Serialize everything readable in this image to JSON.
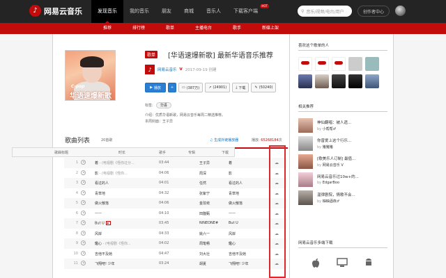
{
  "app": {
    "brand": "网易云音乐",
    "logo_glyph": "♪"
  },
  "nav": [
    "发现音乐",
    "我的音乐",
    "朋友",
    "商城",
    "音乐人",
    "下载客户端"
  ],
  "nav_hot": "HOT",
  "search": {
    "placeholder": "音乐/视频/电台/用户"
  },
  "creator_center": "创作者中心",
  "subnav": [
    "推荐",
    "排行榜",
    "歌单",
    "主播电台",
    "歌手",
    "新碟上架"
  ],
  "playlist": {
    "tag": "歌单",
    "title": "[华语速爆新歌] 最新华语音乐推荐",
    "cover_cpop": "C-pop",
    "cover_title": "华语速爆新歌",
    "creator": "网易云音乐",
    "creator_badge": "V",
    "date": "2017-09-19 创建",
    "buttons": {
      "play": "播放",
      "collect": "(387万)",
      "share": "(24901)",
      "download": "下载",
      "comment": "(50240)"
    },
    "tags_label": "标签:",
    "tag_value": "华语",
    "intro": "介绍：优质华语新歌，网易云音乐每周二精选推荐。",
    "update": "本周封面：王子异"
  },
  "list": {
    "title": "歌曲列表",
    "count": "20首歌",
    "external": "生成外链播放器",
    "plays_label": "播放:",
    "plays_value": "65268184",
    "plays_unit": "次",
    "headers": {
      "title": "歌曲标题",
      "time": "时长",
      "singer": "歌手",
      "album": "专辑",
      "download": "下载"
    },
    "rows": [
      {
        "num": "1",
        "name": "着",
        "alias": " - (电视剧《怪你过分...",
        "time": "03:44",
        "singer": "王子异",
        "album": "着",
        "mv": false
      },
      {
        "num": "2",
        "name": "影",
        "alias": " - (电视剧《怪你...",
        "time": "04:06",
        "singer": "周深",
        "album": "影",
        "mv": false
      },
      {
        "num": "3",
        "name": "看过的人",
        "alias": "",
        "time": "04:01",
        "singer": "任然",
        "album": "看过的人",
        "mv": false
      },
      {
        "num": "4",
        "name": "青草地",
        "alias": "",
        "time": "04:32",
        "singer": "张紫宁",
        "album": "青草地",
        "mv": false
      },
      {
        "num": "5",
        "name": "做火散落",
        "alias": "",
        "time": "04:06",
        "singer": "金玟岐",
        "album": "做火散落",
        "mv": false
      },
      {
        "num": "6",
        "name": "——",
        "alias": "",
        "time": "04:10",
        "singer": "田馥甄",
        "album": "——",
        "mv": false
      },
      {
        "num": "7",
        "name": "But U",
        "alias": "",
        "time": "03:45",
        "singer": "NINEONE#",
        "album": "But U",
        "mv": true
      },
      {
        "num": "8",
        "name": "风岸",
        "alias": "",
        "time": "04:33",
        "singer": "姚六一",
        "album": "风岸",
        "mv": false
      },
      {
        "num": "9",
        "name": "鑑心",
        "alias": " - (电视剧《怪你...",
        "time": "04:02",
        "singer": "周笔畅",
        "album": "鑑心",
        "mv": false
      },
      {
        "num": "10",
        "name": "吉他不及她",
        "alias": "",
        "time": "04:47",
        "singer": "刘大壮",
        "album": "吉他不及她",
        "mv": false
      },
      {
        "num": "11",
        "name": "飞翔吧! 少年",
        "alias": "",
        "time": "03:24",
        "singer": "胡夏",
        "album": "飞翔吧! 少年",
        "mv": false
      }
    ]
  },
  "sidebar": {
    "likers_title": "喜欢这个歌单的人",
    "related_title": "相关推荐",
    "related": [
      {
        "title": "神仙翻唱：被人遗...",
        "by": "by",
        "user": "小帮帮♂"
      },
      {
        "title": "你曾爱上这个行乐...",
        "by": "by",
        "user": "猪猪猪"
      },
      {
        "title": "[歌美乐人订制] 最值...",
        "by": "by",
        "user": "网易云音乐 V"
      },
      {
        "title": "网易云音乐过10w+的...",
        "by": "by",
        "user": "EdgarBoo"
      },
      {
        "title": "温律剧院，情歌不会...",
        "by": "by",
        "user": "柚柚酒夜♂"
      }
    ],
    "download_title": "网易云音乐多端下载"
  },
  "colors": {
    "brand_red": "#c20c0c",
    "topbar": "#242424",
    "link_blue": "#0c73c2"
  }
}
